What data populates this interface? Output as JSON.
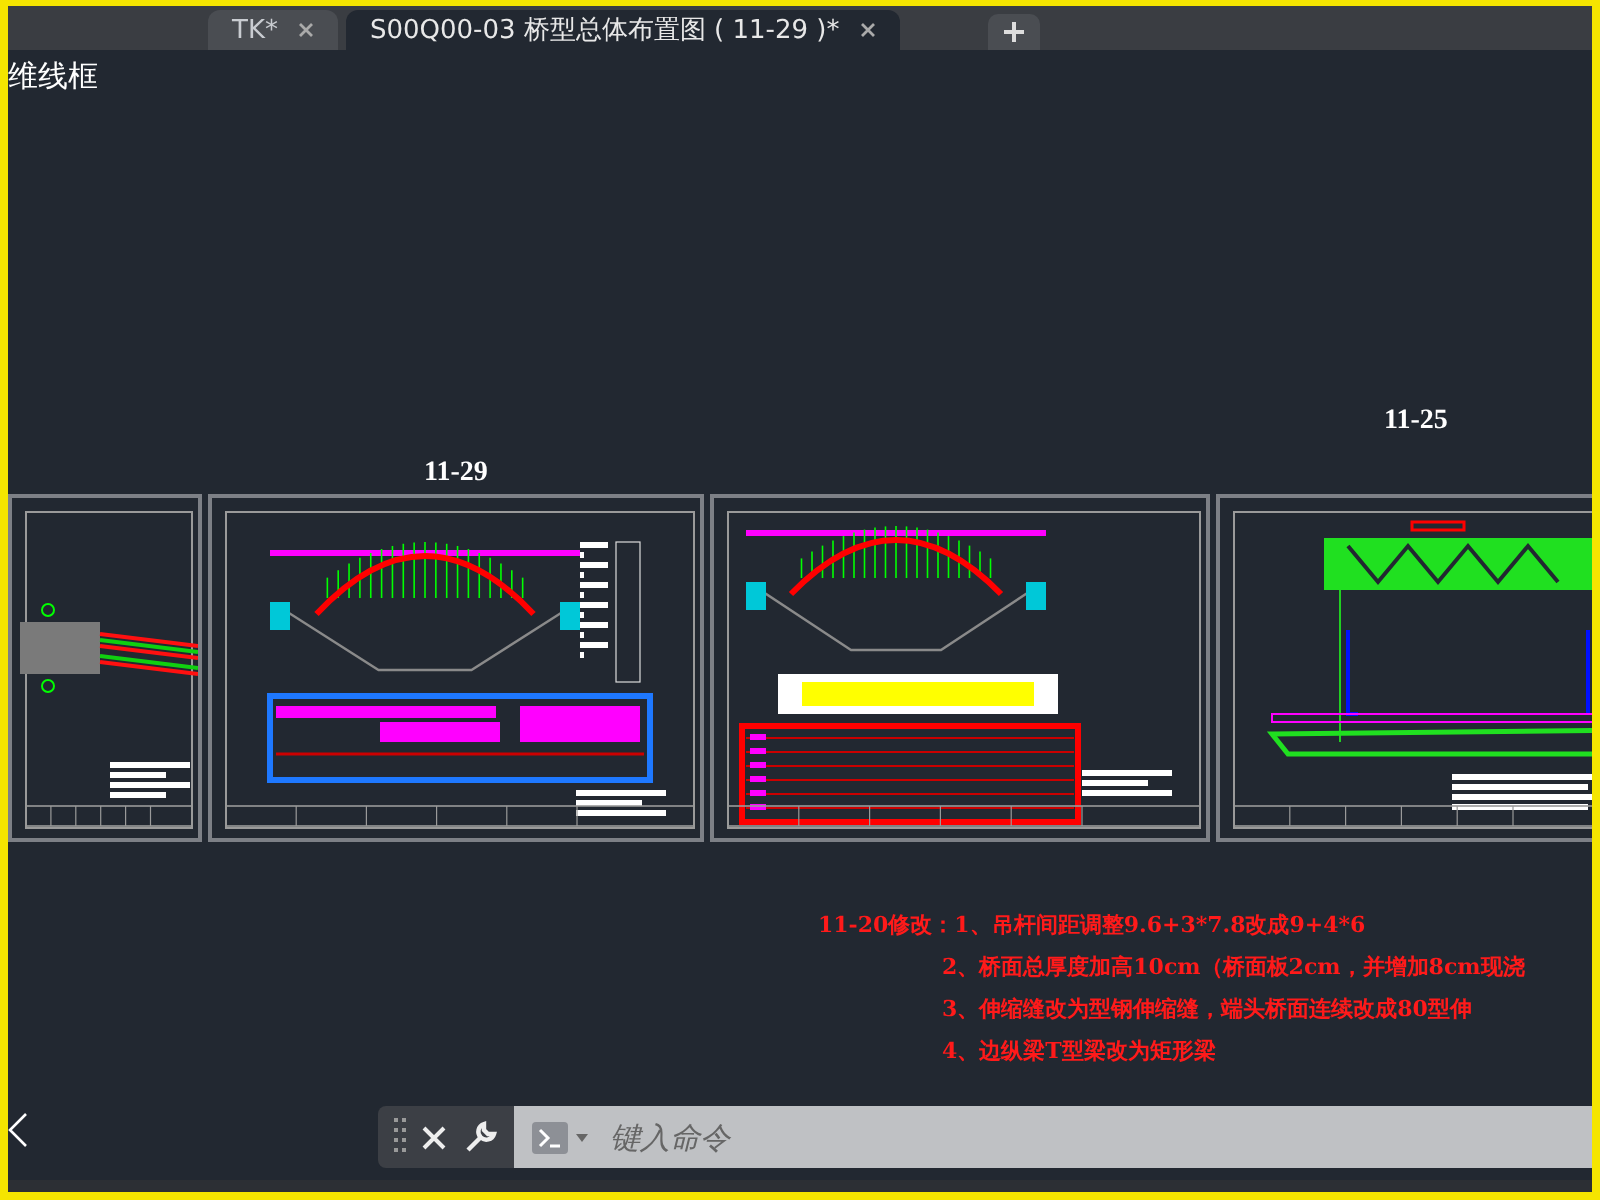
{
  "tabs": [
    {
      "label": "TK*",
      "selected": false
    },
    {
      "label": "S00Q00-03 桥型总体布置图 ( 11-29 )*",
      "selected": true
    }
  ],
  "viewport_label": "维线框",
  "sheets": [
    {
      "kind": "plan"
    },
    {
      "kind": "arch",
      "label": "11-29"
    },
    {
      "kind": "arch-table"
    },
    {
      "kind": "truss",
      "label": "11-25"
    }
  ],
  "notes": [
    "11-20修改：1、吊杆间距调整9.6+3*7.8改成9+4*6",
    "2、桥面总厚度加高10cm（桥面板2cm，并增加8cm现浇",
    "3、伸缩缝改为型钢伸缩缝，端头桥面连续改成80型伸",
    "4、边纵梁T型梁改为矩形梁"
  ],
  "command_line": {
    "placeholder": "键入命令"
  }
}
